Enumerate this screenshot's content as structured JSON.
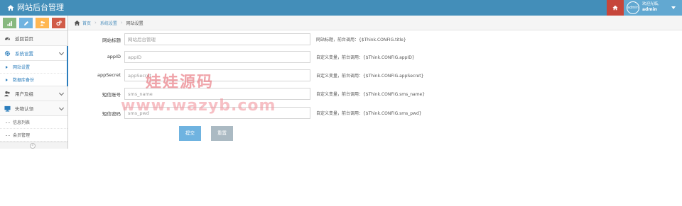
{
  "app": {
    "title": "网站后台管理"
  },
  "user": {
    "avatar_text": "admin",
    "welcome": "欢迎光临,",
    "name": "admin"
  },
  "colors": {
    "topbar": "#438eb9",
    "accent": "#2b7dbc",
    "submit": "#6fb3e0",
    "reset": "#abbac3",
    "home_red": "#c6463b"
  },
  "shortcuts": [
    {
      "icon": "signal-icon"
    },
    {
      "icon": "pencil-icon"
    },
    {
      "icon": "users-icon"
    },
    {
      "icon": "cogs-icon"
    }
  ],
  "sidebar": {
    "items": [
      {
        "label": "返回首页",
        "icon": "dashboard-icon"
      },
      {
        "label": "系统设置",
        "icon": "gear-icon"
      },
      {
        "label": "用户及组",
        "icon": "users-icon"
      },
      {
        "label": "失物认领",
        "icon": "desktop-icon"
      }
    ],
    "system_sub": [
      {
        "label": "网站设置"
      },
      {
        "label": "数据库备份"
      }
    ],
    "claim_sub": [
      {
        "label": "信息列表"
      },
      {
        "label": "会员管理"
      }
    ],
    "collapse_glyph": "«"
  },
  "breadcrumb": {
    "home": "首页",
    "section": "系统设置",
    "current": "网站设置"
  },
  "form": {
    "fields": [
      {
        "label": "网站标题",
        "placeholder": "网站后台管理",
        "help": "网站标题，前台调用：{$Think.CONFIG.title}"
      },
      {
        "label": "appID",
        "placeholder": "appID",
        "help": "自定义变量，前台调用：{$Think.CONFIG.appID}"
      },
      {
        "label": "appSecret",
        "placeholder": "appSecret",
        "help": "自定义变量，前台调用：{$Think.CONFIG.appSecret}"
      },
      {
        "label": "短信账号",
        "placeholder": "sms_name",
        "help": "自定义变量，前台调用：{$Think.CONFIG.sms_name}"
      },
      {
        "label": "短信密码",
        "placeholder": "sms_pwd",
        "help": "自定义变量，前台调用：{$Think.CONFIG.sms_pwd}"
      }
    ],
    "submit_label": "提交",
    "reset_label": "重置"
  },
  "watermark": {
    "line1": "娃娃源码",
    "line2": "www.wazyb.com"
  }
}
